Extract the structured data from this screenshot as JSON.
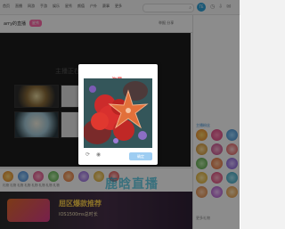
{
  "header": {
    "nav_items": [
      "首页",
      "直播",
      "网游",
      "手游",
      "娱乐",
      "星秀",
      "颜值",
      "户外",
      "赛事",
      "更多"
    ],
    "avatar_label": "TE"
  },
  "room": {
    "name": "arry的直播",
    "tag": "星秀",
    "header_right": "举报 分享"
  },
  "player": {
    "status_text": "主播正在休息"
  },
  "right_panel": {
    "title": "主播粉丝",
    "bottom_text": "更多礼物"
  },
  "bottom_strip": {
    "gift_labels": "礼物 礼物 礼物 礼物 礼物 礼物 礼物 礼物"
  },
  "banner": {
    "main_text": "屈区爆款推荐",
    "sub_text": "IOS1500ms总时长",
    "watermark": "鹿晗直播"
  },
  "captcha": {
    "prompt": "请在下图中点击:",
    "target": "海星",
    "refresh_icon": "refresh-icon",
    "audio_icon": "audio-icon",
    "confirm_label": "确定"
  },
  "colors": {
    "accent": "#2fa0d8",
    "captcha_target": "#f03c3c",
    "confirm_button": "#9ecdf2",
    "banner_text": "#ffd14a"
  }
}
